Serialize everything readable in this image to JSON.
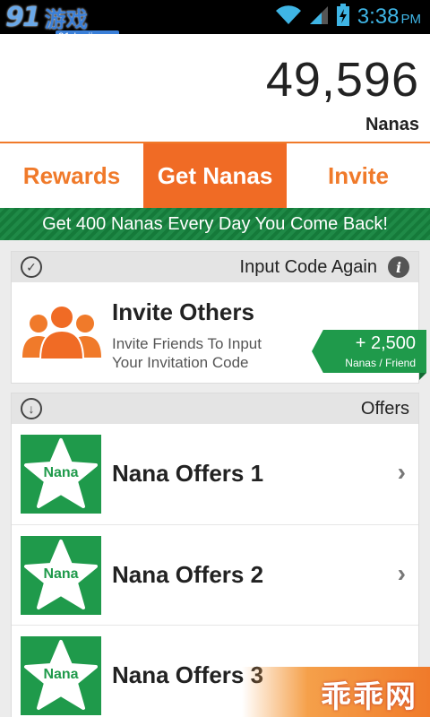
{
  "statusbar": {
    "logo_number": "91",
    "logo_text": "游戏",
    "logo_url": "91danji.com",
    "time": "3:38",
    "ampm": "PM"
  },
  "header": {
    "balance": "49,596",
    "balance_unit": "Nanas"
  },
  "tabs": [
    {
      "label": "Rewards",
      "active": false
    },
    {
      "label": "Get Nanas",
      "active": true
    },
    {
      "label": "Invite",
      "active": false
    }
  ],
  "banner": {
    "text": "Get 400 Nanas Every Day You Come Back!"
  },
  "invite_card": {
    "head_text": "Input Code Again",
    "title": "Invite Others",
    "description": "Invite Friends To Input Your Invitation Code",
    "reward_amount": "+ 2,500",
    "reward_unit": "Nanas / Friend"
  },
  "offers_card": {
    "head_text": "Offers",
    "items": [
      {
        "thumb_label": "Nana",
        "title": "Nana Offers 1"
      },
      {
        "thumb_label": "Nana",
        "title": "Nana Offers 2"
      },
      {
        "thumb_label": "Nana",
        "title": "Nana Offers 3"
      }
    ]
  },
  "watermark": {
    "text": "乖乖网"
  },
  "colors": {
    "accent_orange": "#f06b25",
    "accent_green": "#1f9a4b",
    "status_blue": "#3fb5e5"
  }
}
